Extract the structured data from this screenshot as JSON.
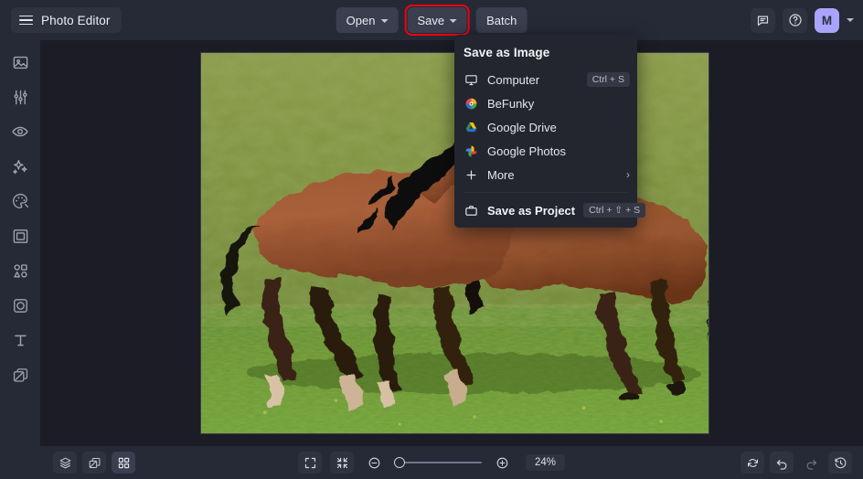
{
  "app": {
    "title": "Photo Editor",
    "accent_red": "#f3000f",
    "avatar_bg": "#a9a4fb",
    "header_bg": "#262936",
    "canvas_bg": "#1b1c26"
  },
  "header": {
    "menu_icon": "hamburger-icon",
    "buttons": [
      {
        "label": "Open",
        "has_caret": true,
        "highlighted": false
      },
      {
        "label": "Save",
        "has_caret": true,
        "highlighted": true
      },
      {
        "label": "Batch",
        "has_caret": false,
        "highlighted": false
      }
    ],
    "right": {
      "feedback_icon": "chat-bubble-icon",
      "help_icon": "question-circle-icon",
      "avatar_initial": "M",
      "account_caret": "chevron-down-icon"
    }
  },
  "sidebar": {
    "items": [
      {
        "name": "image",
        "icon": "image-icon"
      },
      {
        "name": "edit",
        "icon": "sliders-icon"
      },
      {
        "name": "touch-up",
        "icon": "eye-icon"
      },
      {
        "name": "effects",
        "icon": "sparkles-icon"
      },
      {
        "name": "artsy",
        "icon": "palette-icon"
      },
      {
        "name": "frames",
        "icon": "frame-icon"
      },
      {
        "name": "graphics",
        "icon": "shapes-icon"
      },
      {
        "name": "overlays",
        "icon": "overlay-icon"
      },
      {
        "name": "text",
        "icon": "text-icon"
      },
      {
        "name": "layers",
        "icon": "layers-stack-icon"
      }
    ]
  },
  "save_menu": {
    "title": "Save as Image",
    "items": [
      {
        "label": "Computer",
        "icon": "monitor-icon",
        "shortcut": "Ctrl + S",
        "chevron": false,
        "bold": false
      },
      {
        "label": "BeFunky",
        "icon": "befunky-logo-icon",
        "shortcut": "",
        "chevron": false,
        "bold": false
      },
      {
        "label": "Google Drive",
        "icon": "google-drive-icon",
        "shortcut": "",
        "chevron": false,
        "bold": false
      },
      {
        "label": "Google Photos",
        "icon": "google-photos-icon",
        "shortcut": "",
        "chevron": false,
        "bold": false
      },
      {
        "label": "More",
        "icon": "plus-icon",
        "shortcut": "",
        "chevron": true,
        "bold": false
      }
    ],
    "footer": {
      "label": "Save as Project",
      "icon": "briefcase-icon",
      "shortcut": "Ctrl + ⇧ + S",
      "bold": true
    }
  },
  "bottom_bar": {
    "left_tools": [
      {
        "name": "layers",
        "icon": "layers-icon",
        "active": false
      },
      {
        "name": "transform",
        "icon": "duplicate-icon",
        "active": false
      },
      {
        "name": "grid",
        "icon": "grid-icon",
        "active": true
      }
    ],
    "view_tools": [
      {
        "name": "fit-screen",
        "icon": "expand-corners-icon"
      },
      {
        "name": "actual-size",
        "icon": "collapse-corners-icon"
      }
    ],
    "zoom": {
      "out_icon": "minus-circle-icon",
      "in_icon": "plus-circle-icon",
      "level": "24%",
      "slider_position_pct": 0
    },
    "right_tools": [
      {
        "name": "reset",
        "icon": "refresh-icon",
        "boxed": true,
        "dimmed": false
      },
      {
        "name": "undo",
        "icon": "undo-arrow-icon",
        "boxed": true,
        "dimmed": false
      },
      {
        "name": "redo",
        "icon": "redo-arrow-icon",
        "boxed": false,
        "dimmed": true
      },
      {
        "name": "history",
        "icon": "history-clock-icon",
        "boxed": true,
        "dimmed": false
      }
    ]
  },
  "photo": {
    "alt": "Two brown horses running on green grass, oil-paint filter applied",
    "zoom_label": "24%"
  }
}
